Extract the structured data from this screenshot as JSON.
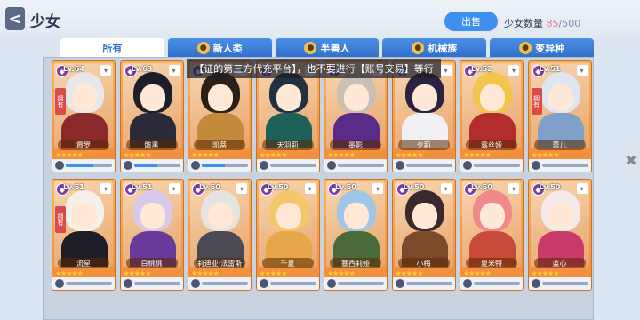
{
  "header": {
    "back_label": "<",
    "title": "少女",
    "sell_button": "出售",
    "count_label": "少女数量",
    "count_current": "85",
    "count_sep": "/",
    "count_max": "500"
  },
  "tabs": [
    {
      "label": "所有",
      "active": true,
      "icon": ""
    },
    {
      "label": "新人类",
      "active": false,
      "icon": "human-race-icon"
    },
    {
      "label": "半兽人",
      "active": false,
      "icon": "beastman-race-icon"
    },
    {
      "label": "机械族",
      "active": false,
      "icon": "mech-race-icon"
    },
    {
      "label": "变异种",
      "active": false,
      "icon": "mutant-race-icon"
    }
  ],
  "notice": "【证的第三方代充平台】，也不要进行【账号交易】等行",
  "cards": [
    {
      "name": "霞罗",
      "level": "Lv.64",
      "owned": "拥有",
      "stars": "★★★★★",
      "hair": "#e8e8ea",
      "outfit": "#8a2a2a",
      "progress": 0.6
    },
    {
      "name": "骸黑",
      "level": "Lv.63",
      "owned": "",
      "stars": "★★★★★",
      "hair": "#1e1e2a",
      "outfit": "#2a2a38",
      "progress": 0.5
    },
    {
      "name": "凯蒂",
      "level": "Lv.60",
      "owned": "",
      "stars": "★★★★★",
      "hair": "#2a2018",
      "outfit": "#c28a3a",
      "progress": 0.5
    },
    {
      "name": "天羽莉",
      "level": "Lv.58",
      "owned": "",
      "stars": "★★★★★",
      "hair": "#233040",
      "outfit": "#1f5f5a",
      "progress": 0
    },
    {
      "name": "墨影",
      "level": "Lv.55",
      "owned": "",
      "stars": "★★★★★",
      "hair": "#c8c0b6",
      "outfit": "#5b2b8a",
      "progress": 0
    },
    {
      "name": "夕莉",
      "level": "Lv.53",
      "owned": "",
      "stars": "★★★★★",
      "hair": "#2a2340",
      "outfit": "#f0f0f5",
      "progress": 0
    },
    {
      "name": "露丝娅",
      "level": "Lv.52",
      "owned": "",
      "stars": "★★★★★",
      "hair": "#f1c64a",
      "outfit": "#b22d2d",
      "progress": 0
    },
    {
      "name": "蕾儿",
      "level": "Lv.51",
      "owned": "拥有",
      "stars": "★★★★★",
      "hair": "#dfe6f2",
      "outfit": "#7fa0c8",
      "progress": 0
    },
    {
      "name": "流星",
      "level": "Lv.51",
      "owned": "拥有",
      "stars": "★★★★★",
      "hair": "#f4f0e8",
      "outfit": "#1d1d28",
      "progress": 0
    },
    {
      "name": "白桃桃",
      "level": "Lv.51",
      "owned": "",
      "stars": "★★★★★",
      "hair": "#d8c8ea",
      "outfit": "#6a3a9a",
      "progress": 0
    },
    {
      "name": "莉迪亚·法雷斯",
      "level": "Lv.50",
      "owned": "",
      "stars": "★★★★★",
      "hair": "#e6e4e0",
      "outfit": "#4a4a54",
      "progress": 0
    },
    {
      "name": "千夏",
      "level": "Lv.50",
      "owned": "",
      "stars": "★★★★★",
      "hair": "#f2c86a",
      "outfit": "#e7a64a",
      "progress": 0
    },
    {
      "name": "塞西莉娅",
      "level": "Lv.50",
      "owned": "",
      "stars": "★★★★★",
      "hair": "#9fc6e8",
      "outfit": "#4a6a3a",
      "progress": 0
    },
    {
      "name": "小梅",
      "level": "Lv.50",
      "owned": "",
      "stars": "★★★★★",
      "hair": "#3a2a30",
      "outfit": "#7a4a2a",
      "progress": 0
    },
    {
      "name": "夏米特",
      "level": "Lv.50",
      "owned": "",
      "stars": "★★★★★",
      "hair": "#f08a8a",
      "outfit": "#c84a3a",
      "progress": 0
    },
    {
      "name": "蓝心",
      "level": "Lv.50",
      "owned": "",
      "stars": "★★★★★",
      "hair": "#f4eaea",
      "outfit": "#c83a6a",
      "progress": 0
    }
  ],
  "colors": {
    "accent": "#3f8ff0",
    "card_orange": "#f08a3a",
    "star": "#ffcf2e"
  }
}
